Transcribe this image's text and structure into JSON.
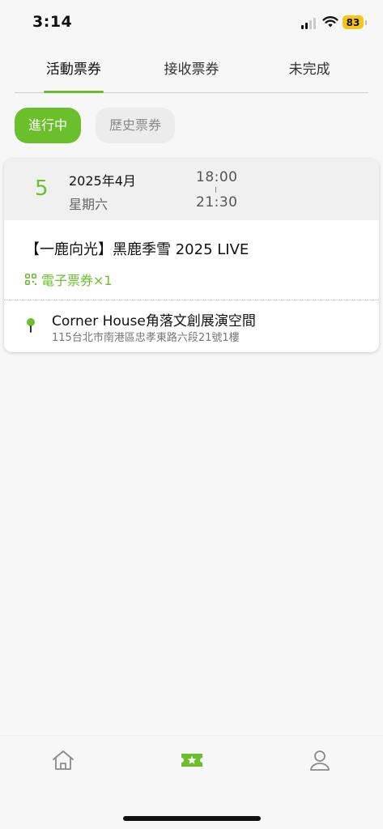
{
  "status_bar": {
    "time": "3:14",
    "battery": "83",
    "battery_color": "#f5c518"
  },
  "tabs": [
    {
      "label": "活動票券",
      "active": true
    },
    {
      "label": "接收票券",
      "active": false
    },
    {
      "label": "未完成",
      "active": false
    }
  ],
  "filters": {
    "active_label": "進行中",
    "history_label": "歷史票券"
  },
  "event": {
    "day": "5",
    "year_month": "2025年4月",
    "weekday": "星期六",
    "start_time": "18:00",
    "end_time": "21:30",
    "title": "【一鹿向光】黑鹿季雪 2025 LIVE",
    "eticket": "電子票券×1",
    "venue_name": "Corner House角落文創展演空間",
    "venue_address": "115台北市南港區忠孝東路六段21號1樓"
  },
  "bottom_nav": {
    "items": [
      "home-icon",
      "ticket-icon",
      "profile-icon"
    ],
    "active_color": "#6bbf2a",
    "inactive_color": "#8a8a8a"
  },
  "accent_color": "#6bbf2a"
}
